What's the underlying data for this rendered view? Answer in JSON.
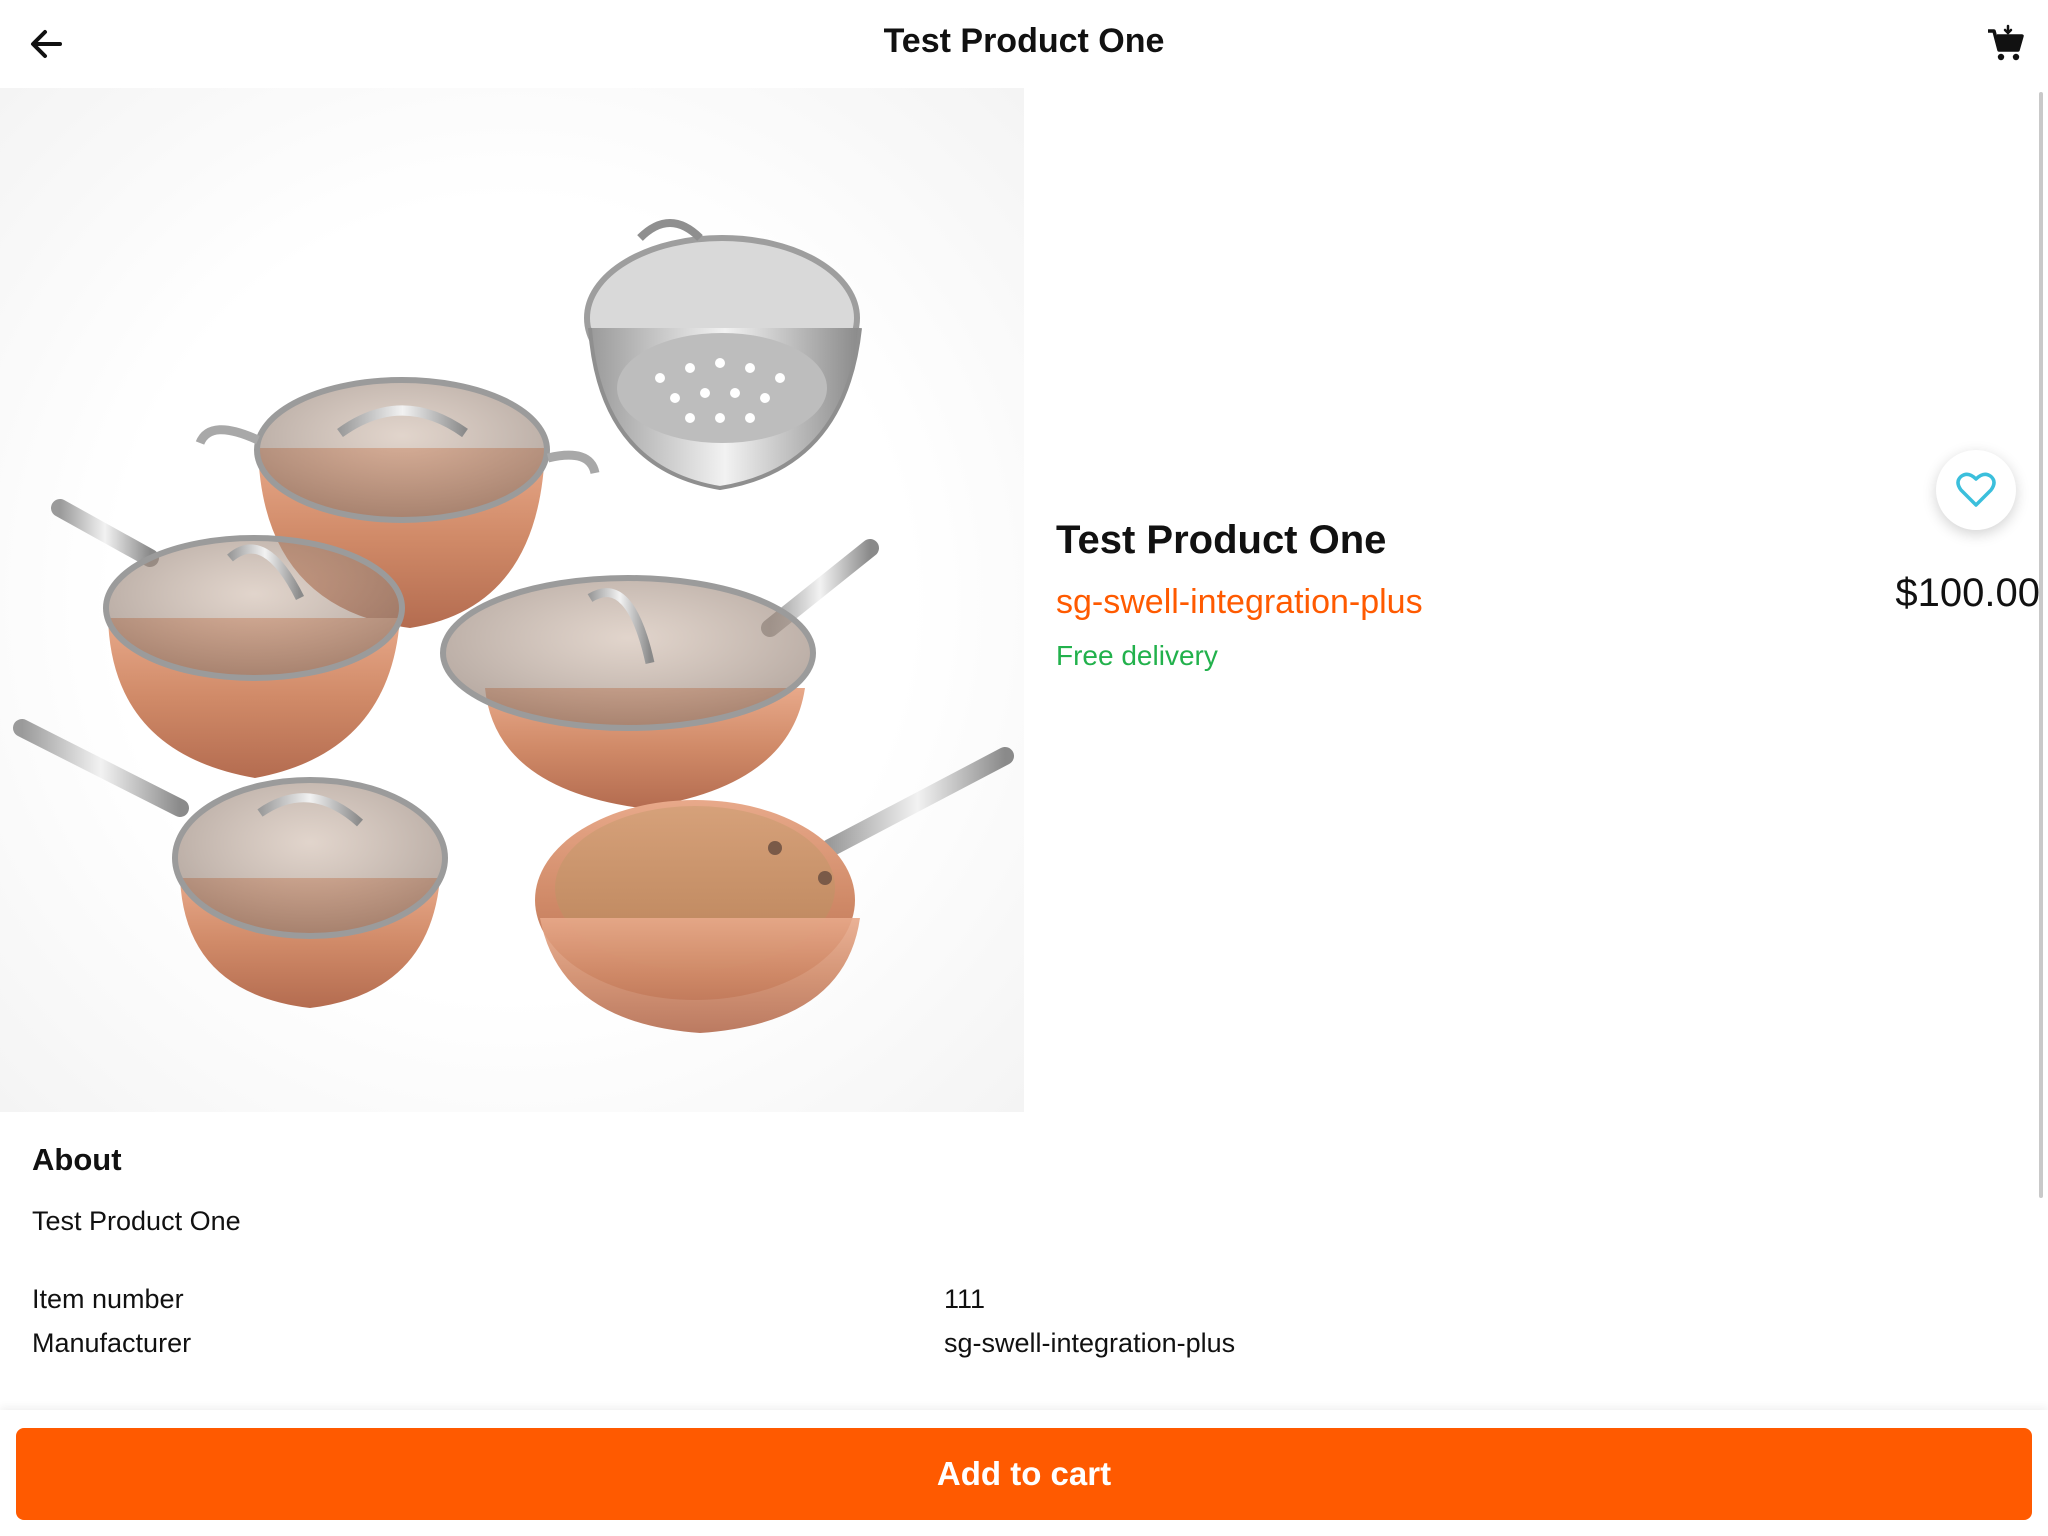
{
  "header": {
    "title": "Test Product One",
    "back_icon": "arrow-left-icon",
    "cart_icon": "cart-icon"
  },
  "product": {
    "image_alt": "Hammered copper cookware set",
    "name": "Test Product One",
    "vendor": "sg-swell-integration-plus",
    "delivery": "Free delivery",
    "price": "$100.00",
    "favorite_icon": "heart-outline-icon"
  },
  "about": {
    "title": "About",
    "description": "Test Product One",
    "specs": [
      {
        "label": "Item number",
        "value": "111"
      },
      {
        "label": "Manufacturer",
        "value": "sg-swell-integration-plus"
      }
    ]
  },
  "actions": {
    "add_to_cart": "Add to cart"
  },
  "colors": {
    "accent": "#ff5a00",
    "delivery": "#22b14c",
    "favorite": "#3bbfdc"
  }
}
